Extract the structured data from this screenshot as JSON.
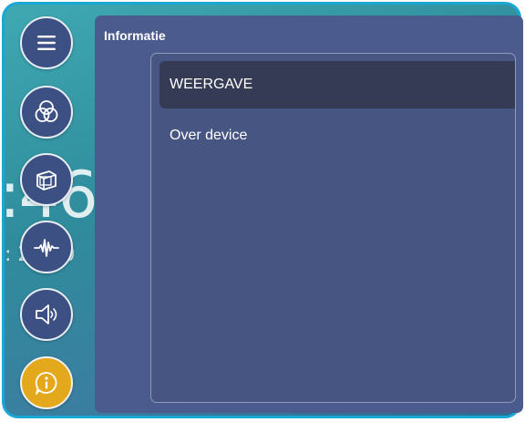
{
  "background": {
    "clock_fragment": ":46",
    "date_fragment": ": 2 020"
  },
  "sidebar": {
    "items": [
      {
        "icon": "menu-icon"
      },
      {
        "icon": "color-circles-icon"
      },
      {
        "icon": "display-cube-icon"
      },
      {
        "icon": "audio-wave-icon"
      },
      {
        "icon": "speaker-icon"
      },
      {
        "icon": "info-icon",
        "active": true
      }
    ]
  },
  "panel": {
    "title": "Informatie",
    "items": [
      {
        "label": "WEERGAVE",
        "selected": true
      },
      {
        "label": "Over device",
        "selected": false
      }
    ]
  },
  "colors": {
    "panel": "#4c5b8e",
    "selected_item": "#363b55",
    "active_button": "#e4a81c",
    "nav_button": "#3c5084"
  }
}
